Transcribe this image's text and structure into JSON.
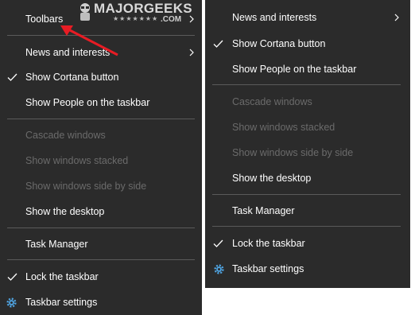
{
  "watermark": {
    "name": "MAJORGEEKS",
    "stars": "★★★★★★★",
    "suffix": ".COM"
  },
  "left_menu": {
    "toolbars": "Toolbars",
    "news": "News and interests",
    "cortana": "Show Cortana button",
    "people": "Show People on the taskbar",
    "cascade": "Cascade windows",
    "stacked": "Show windows stacked",
    "side_by_side": "Show windows side by side",
    "desktop": "Show the desktop",
    "task_manager": "Task Manager",
    "lock": "Lock the taskbar",
    "settings": "Taskbar settings"
  },
  "right_menu": {
    "news": "News and interests",
    "cortana": "Show Cortana button",
    "people": "Show People on the taskbar",
    "cascade": "Cascade windows",
    "stacked": "Show windows stacked",
    "side_by_side": "Show windows side by side",
    "desktop": "Show the desktop",
    "task_manager": "Task Manager",
    "lock": "Lock the taskbar",
    "settings": "Taskbar settings"
  },
  "icons": {
    "submenu": "chevron-right-icon",
    "check": "checkmark-icon",
    "settings": "gear-icon",
    "annotation": "red-arrow-icon"
  },
  "colors": {
    "menu_bg": "#2b2b2b",
    "text": "#ffffff",
    "disabled_text": "#6b6b6b",
    "separator": "#5a5a5a",
    "arrow": "#e81c24",
    "gear": "#4fa3e0"
  }
}
